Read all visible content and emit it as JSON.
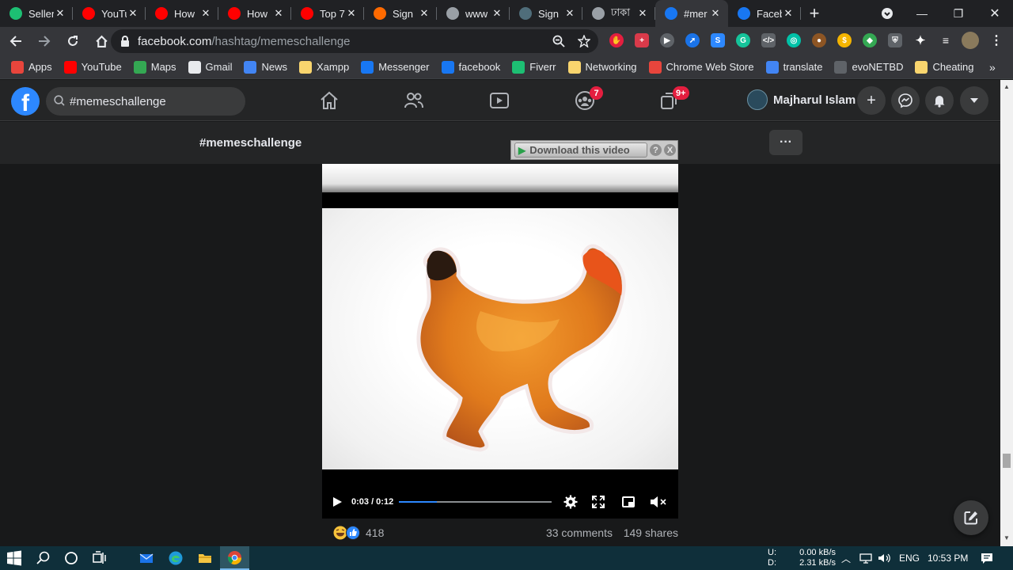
{
  "browser": {
    "tabs": [
      {
        "title": "Seller",
        "icon": "fiverr-icon",
        "color": "#1dbf73"
      },
      {
        "title": "YouTu",
        "icon": "youtube-icon",
        "color": "#ff0000"
      },
      {
        "title": "How",
        "icon": "youtube-icon",
        "color": "#ff0000"
      },
      {
        "title": "How",
        "icon": "youtube-icon",
        "color": "#ff0000"
      },
      {
        "title": "Top 7",
        "icon": "youtube-icon",
        "color": "#ff0000"
      },
      {
        "title": "Sign",
        "icon": "sign-icon",
        "color": "#ff6a00"
      },
      {
        "title": "www",
        "icon": "cloud-icon",
        "color": "#9aa0a6"
      },
      {
        "title": "Sign",
        "icon": "sign-icon",
        "color": "#4f6d7a"
      },
      {
        "title": "ঢাকা",
        "icon": "globe-icon",
        "color": "#9aa0a6"
      },
      {
        "title": "#mer",
        "icon": "facebook-icon",
        "color": "#1877f2"
      },
      {
        "title": "Faceb",
        "icon": "facebook-icon",
        "color": "#1877f2"
      }
    ],
    "active_tab": 9,
    "url_host": "facebook.com",
    "url_path": "/hashtag/memeschallenge",
    "bookmarks": [
      {
        "label": "Apps",
        "icon": "apps-grid-icon",
        "color": "#e8453c"
      },
      {
        "label": "YouTube",
        "icon": "youtube-icon",
        "color": "#ff0000"
      },
      {
        "label": "Maps",
        "icon": "maps-pin-icon",
        "color": "#34a853"
      },
      {
        "label": "Gmail",
        "icon": "globe-icon",
        "color": "#e8eaed"
      },
      {
        "label": "News",
        "icon": "news-icon",
        "color": "#4285f4"
      },
      {
        "label": "Xampp",
        "icon": "folder-icon",
        "color": "#f9d56e"
      },
      {
        "label": "Messenger",
        "icon": "facebook-icon",
        "color": "#1877f2"
      },
      {
        "label": "facebook",
        "icon": "facebook-icon",
        "color": "#1877f2"
      },
      {
        "label": "Fiverr",
        "icon": "fiverr-icon",
        "color": "#1dbf73"
      },
      {
        "label": "Networking",
        "icon": "folder-icon",
        "color": "#f9d56e"
      },
      {
        "label": "Chrome Web Store",
        "icon": "store-icon",
        "color": "#e8453c"
      },
      {
        "label": "translate",
        "icon": "translate-icon",
        "color": "#4285f4"
      },
      {
        "label": "evoNETBD",
        "icon": "folder-icon",
        "color": "#5f6368"
      },
      {
        "label": "Cheating",
        "icon": "folder-icon",
        "color": "#f9d56e"
      }
    ]
  },
  "facebook": {
    "search_value": "#memeschallenge",
    "groups_badge": "7",
    "gaming_badge": "9+",
    "profile_name": "Majharul Islam",
    "hashtag_title": "#memeschallenge"
  },
  "download_bar": {
    "label": "Download this video",
    "help": "?",
    "close": "X"
  },
  "video": {
    "time": "0:03 / 0:12",
    "progress": 0.25
  },
  "reactions": {
    "count": "418",
    "comments": "33 comments",
    "shares": "149 shares"
  },
  "taskbar": {
    "net_upload_label": "U:",
    "net_download_label": "D:",
    "net_upload": "0.00 kB/s",
    "net_download": "2.31 kB/s",
    "language": "ENG",
    "time": "10:53 PM"
  },
  "colors": {
    "fb_blue": "#2d88ff",
    "badge_red": "#e41e3f"
  }
}
